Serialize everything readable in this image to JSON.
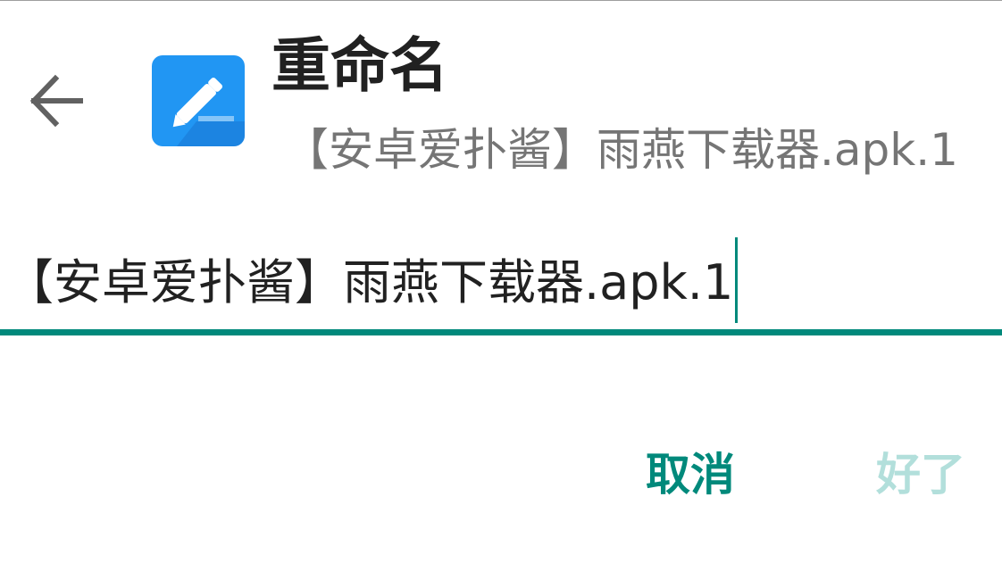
{
  "dialog": {
    "title": "重命名",
    "subtitle": "【安卓爱扑酱】雨燕下载器.apk.1"
  },
  "icons": {
    "back": "arrow-left-icon",
    "app": "pencil-edit-icon"
  },
  "field": {
    "value": "【安卓爱扑酱】雨燕下载器.apk.1"
  },
  "actions": {
    "cancel_label": "取消",
    "ok_label": "好了",
    "ok_enabled": false
  },
  "colors": {
    "accent": "#00897b",
    "accent_disabled": "#b2dfdb",
    "app_icon": "#2196f3",
    "title": "#212121",
    "subtitle": "#757575"
  }
}
